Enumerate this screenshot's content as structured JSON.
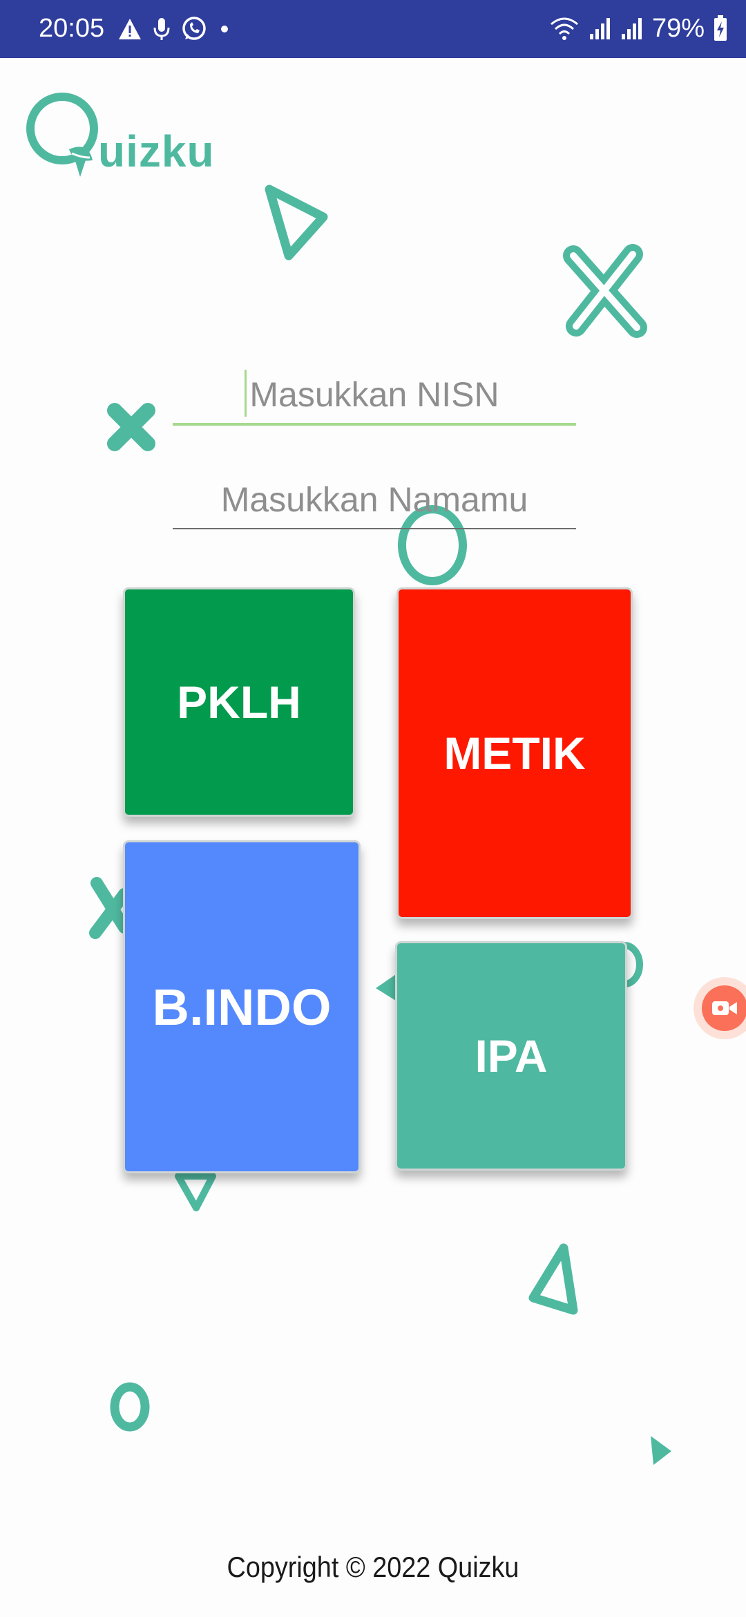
{
  "status_bar": {
    "time": "20:05",
    "battery": "79%",
    "left_icons": [
      "warning-icon",
      "microphone-icon",
      "whatsapp-icon",
      "dot-icon"
    ],
    "right_icons": [
      "wifi-icon",
      "signal-icon",
      "signal-icon",
      "battery-charging-icon"
    ]
  },
  "app": {
    "logo_text": "uizku"
  },
  "form": {
    "nisn_placeholder": "Masukkan NISN",
    "name_placeholder": "Masukkan Namamu"
  },
  "subjects": [
    {
      "label": "PKLH",
      "color": "#029a4c"
    },
    {
      "label": "METIK",
      "color": "#ff1800"
    },
    {
      "label": "B.INDO",
      "color": "#5489fd"
    },
    {
      "label": "IPA",
      "color": "#4eb9a0"
    }
  ],
  "footer": {
    "copyright": "Copyright © 2022 Quizku"
  },
  "colors": {
    "status_bar": "#2f3d9c",
    "accent": "#4fb9a0",
    "nisn_underline": "#a6d98e",
    "fab": "#fb7058"
  },
  "floating_button": {
    "icon": "video-camera-icon"
  }
}
